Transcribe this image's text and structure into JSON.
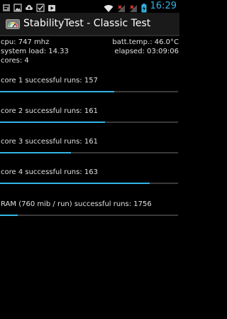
{
  "status_bar": {
    "time": "16:29",
    "left_icons": [
      "notification-icon",
      "image-icon",
      "upload-icon",
      "checkbox-icon",
      "play-store-icon"
    ],
    "right_icons": [
      "wifi-icon",
      "signal-no-service-icon",
      "signal-no-service-icon",
      "battery-charging-icon"
    ],
    "accent": "#33b5e5"
  },
  "app": {
    "title": "StabilityTest - Classic Test",
    "icon": "stabilitytest-app-icon"
  },
  "info": {
    "cpu": "cpu: 747 mhz",
    "batt_temp": "batt.temp.: 46.0°C",
    "system_load": "system load: 14.33",
    "elapsed": "elapsed: 03:09:06",
    "cores": "cores: 4"
  },
  "tests": [
    {
      "label": "core 1 successful runs: 157",
      "progress": 0.64
    },
    {
      "label": "core 2 successful runs: 161",
      "progress": 0.59
    },
    {
      "label": "core 3 successful runs: 161",
      "progress": 0.4
    },
    {
      "label": "core 4 successful runs: 163",
      "progress": 0.84
    },
    {
      "label": "RAM (760 mib / run) successful runs: 1756",
      "progress": 0.1
    }
  ]
}
